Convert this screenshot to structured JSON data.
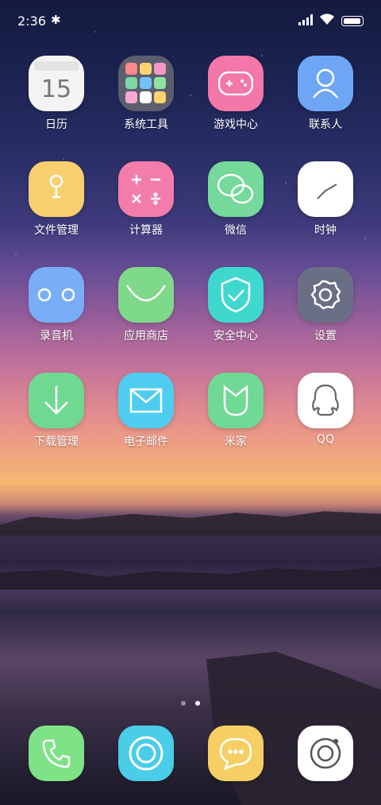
{
  "status": {
    "time": "2:36"
  },
  "apps": [
    {
      "label": "日历",
      "icon": "calendar-icon",
      "color": "#f3f3f3",
      "day": "15"
    },
    {
      "label": "系统工具",
      "icon": "folder-icon",
      "color": "#5b5e6e"
    },
    {
      "label": "游戏中心",
      "icon": "gamepad-icon",
      "color": "#f377a8"
    },
    {
      "label": "联系人",
      "icon": "contacts-icon",
      "color": "#6ea6f5"
    },
    {
      "label": "文件管理",
      "icon": "file-icon",
      "color": "#f7cf6e"
    },
    {
      "label": "计算器",
      "icon": "calculator-icon",
      "color": "#f47cab"
    },
    {
      "label": "微信",
      "icon": "wechat-icon",
      "color": "#74d99a"
    },
    {
      "label": "时钟",
      "icon": "clock-icon",
      "color": "#ffffff"
    },
    {
      "label": "录音机",
      "icon": "recorder-icon",
      "color": "#79adf7"
    },
    {
      "label": "应用商店",
      "icon": "store-icon",
      "color": "#7fd98a"
    },
    {
      "label": "安全中心",
      "icon": "shield-icon",
      "color": "#3ed8cf"
    },
    {
      "label": "设置",
      "icon": "gear-icon",
      "color": "#6b6f86"
    },
    {
      "label": "下载管理",
      "icon": "download-icon",
      "color": "#6fd991"
    },
    {
      "label": "电子邮件",
      "icon": "mail-icon",
      "color": "#4fcdf0"
    },
    {
      "label": "米家",
      "icon": "mijia-icon",
      "color": "#6fd995"
    },
    {
      "label": "QQ",
      "icon": "qq-icon",
      "color": "#ffffff"
    }
  ],
  "dock": [
    {
      "icon": "phone-icon",
      "color": "#7ee287"
    },
    {
      "icon": "browser-icon",
      "color": "#49cde8"
    },
    {
      "icon": "message-icon",
      "color": "#f6cf64"
    },
    {
      "icon": "camera-icon",
      "color": "#ffffff"
    }
  ],
  "pages": {
    "count": 2,
    "current": 2
  }
}
